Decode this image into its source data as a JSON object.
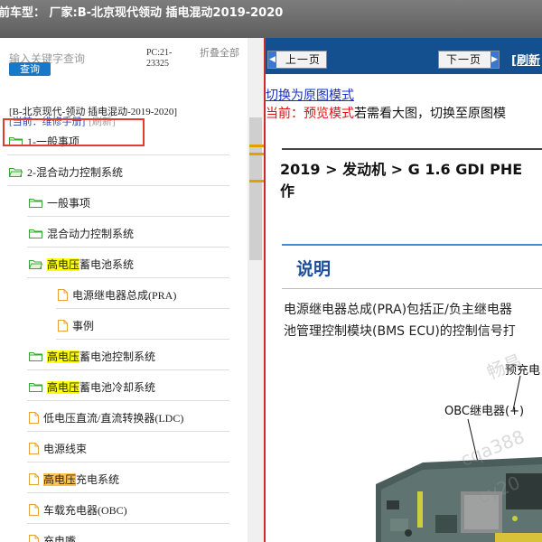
{
  "window": {
    "title": "前车型：  厂家:B-北京现代领动 插电混动2019-2020"
  },
  "search": {
    "placeholder": "输入关键字查询",
    "button": "查询",
    "pc_code": "PC:21-23325",
    "collapse_all": "折叠全部"
  },
  "breadcrumb": {
    "car": "[B-北京现代-领动 插电混动-2019-2020]",
    "current": "[当前：维修手册]",
    "refresh": "[刷新]"
  },
  "tree": [
    {
      "label": "1-一般事项",
      "icon": "folder-icon",
      "level": 0
    },
    {
      "label": "2-混合动力控制系统",
      "icon": "folder-open-icon",
      "level": 0,
      "selected": true
    },
    {
      "label": "一般事项",
      "icon": "folder-icon",
      "level": 1
    },
    {
      "label": "混合动力控制系统",
      "icon": "folder-icon",
      "level": 1
    },
    {
      "label_hl": "高电压",
      "label_rest": "蓄电池系统",
      "icon": "folder-open-icon",
      "level": 1,
      "highlight": "yellow"
    },
    {
      "label": "电源继电器总成(PRA)",
      "icon": "document-icon",
      "level": 2
    },
    {
      "label": "事例",
      "icon": "document-icon",
      "level": 2
    },
    {
      "label_hl": "高电压",
      "label_rest": "蓄电池控制系统",
      "icon": "folder-icon",
      "level": 1,
      "highlight": "yellow"
    },
    {
      "label_hl": "高电压",
      "label_rest": "蓄电池冷却系统",
      "icon": "folder-icon",
      "level": 1,
      "highlight": "yellow"
    },
    {
      "label": "低电压直流/直流转换器(LDC)",
      "icon": "document-icon",
      "level": 1
    },
    {
      "label": "电源线束",
      "icon": "document-icon",
      "level": 1
    },
    {
      "label_hl": "高电压",
      "label_rest": "充电系统",
      "icon": "document-icon",
      "level": 1,
      "highlight": "orange"
    },
    {
      "label": "车载充电器(OBC)",
      "icon": "document-icon",
      "level": 1
    },
    {
      "label": "充电嘴",
      "icon": "document-icon",
      "level": 1
    }
  ],
  "viewer": {
    "prev_button": "上一页",
    "next_button": "下一页",
    "refresh": "[刷新",
    "switch_link": "切换为原图模式",
    "mode_current": "当前：预览模式",
    "mode_hint": "若需看大图，切换至原图模",
    "doc_title_1": "2019 > 发动机 > G 1.6 GDI PHE",
    "doc_title_2": "作",
    "section": "说明",
    "para_1": "电源继电器总成(PRA)包括正/负主继电器",
    "para_2": "池管理控制模块(BMS ECU)的控制信号打",
    "label_precharge": "预充电",
    "label_obc": "OBC继电器(+)"
  },
  "watermark": {
    "line1": "畅昌",
    "line2": "cqa388",
    "line3": "cy20"
  },
  "colors": {
    "accent_blue": "#14508f",
    "selection_red": "#e33b2e",
    "highlight_yellow": "#ffff00",
    "highlight_orange": "#ffc24a",
    "link_blue": "#1730c6",
    "warning_red": "#e01010"
  }
}
